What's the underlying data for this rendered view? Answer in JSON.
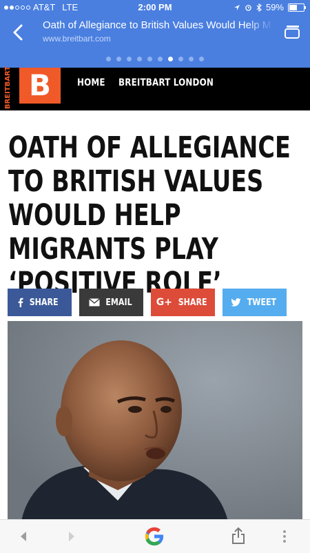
{
  "status_bar": {
    "carrier": "AT&T",
    "network": "LTE",
    "time": "2:00 PM",
    "battery": "59%",
    "battery_level": 0.59
  },
  "amp_header": {
    "title": "Oath of Allegiance to British Values Would Help M",
    "url": "www.breitbart.com",
    "pager_count": 10,
    "pager_active_index": 6
  },
  "site_nav": {
    "logo_vertical": "BREITBART",
    "logo_letter": "B",
    "links": [
      "HOME",
      "BREITBART LONDON"
    ]
  },
  "article": {
    "headline": "OATH OF ALLEGIANCE TO BRITISH VALUES WOULD HELP MIGRANTS PLAY ‘POSITIVE ROLE’"
  },
  "share_buttons": [
    {
      "label": "SHARE",
      "icon": "facebook-icon",
      "color": "#3b5998"
    },
    {
      "label": "EMAIL",
      "icon": "envelope-icon",
      "color": "#3a3a3a"
    },
    {
      "label": "SHARE",
      "icon": "google-plus-icon",
      "icon_text": "G+",
      "color": "#dd4b39"
    },
    {
      "label": "TWEET",
      "icon": "twitter-icon",
      "color": "#55acee"
    }
  ],
  "colors": {
    "header_blue": "#4a7fe0",
    "brand_orange": "#f05a28",
    "nav_black": "#000000"
  }
}
